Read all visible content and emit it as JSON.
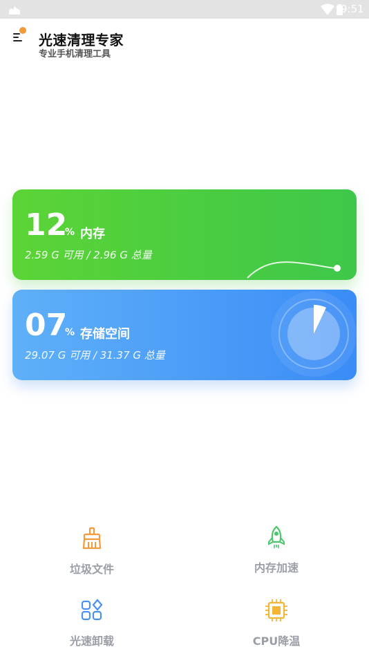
{
  "status_bar": {
    "time": "9:51",
    "icons": [
      "notification-icon",
      "wifi-icon",
      "battery-icon"
    ]
  },
  "header": {
    "title": "光速清理专家",
    "subtitle": "专业手机清理工具",
    "menu_badge_color": "#f39a3a"
  },
  "cards": {
    "memory": {
      "percent": "12",
      "percent_sign": "%",
      "label": "内存",
      "detail": "2.59 G 可用 / 2.96 G 总量",
      "color_start": "#5bd436",
      "color_end": "#3ec74a"
    },
    "storage": {
      "percent": "07",
      "percent_sign": "%",
      "label": "存储空间",
      "detail": "29.07 G 可用 / 31.37 G 总量",
      "color_start": "#5fb0f8",
      "color_end": "#3a8cf7"
    }
  },
  "features": [
    {
      "label": "垃圾文件",
      "icon": "broom-icon",
      "color": "#f39a3a"
    },
    {
      "label": "内存加速",
      "icon": "rocket-icon",
      "color": "#4cc66a"
    },
    {
      "label": "光速卸载",
      "icon": "apps-grid-icon",
      "color": "#4a90f0"
    },
    {
      "label": "CPU降温",
      "icon": "cpu-chip-icon",
      "color": "#f2b535"
    }
  ]
}
